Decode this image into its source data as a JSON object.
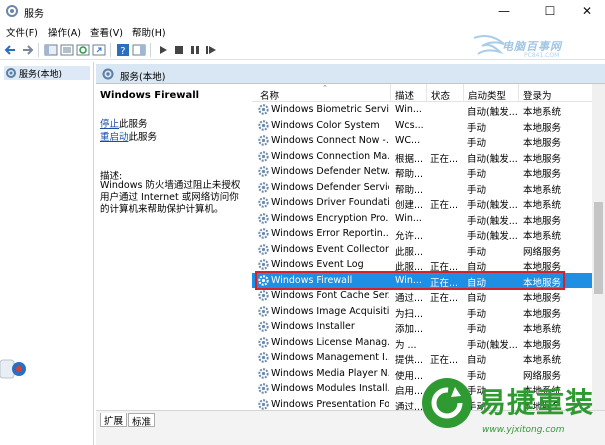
{
  "window": {
    "title": "服务",
    "minimize": "—",
    "maximize": "☐",
    "close": "✕"
  },
  "menu": [
    "文件(F)",
    "操作(A)",
    "查看(V)",
    "帮助(H)"
  ],
  "watermark": {
    "text": "电脑百事网",
    "sub": "PC841.COM"
  },
  "tree": {
    "item": "服务(本地)"
  },
  "panel": {
    "header": "服务(本地)"
  },
  "details": {
    "title": "Windows Firewall",
    "stop_link": "停止",
    "stop_suffix": "此服务",
    "restart_link": "重启动",
    "restart_suffix": "此服务",
    "desc_label": "描述:",
    "desc_text": "Windows 防火墙通过阻止未授权用户通过 Internet 或网络访问你的计算机来帮助保护计算机。"
  },
  "columns": {
    "name": "名称",
    "desc": "描述",
    "status": "状态",
    "startup": "启动类型",
    "logon": "登录为"
  },
  "services": [
    {
      "name": "Windows Biometric Servi...",
      "desc": "Win...",
      "status": "",
      "startup": "自动(触发...",
      "logon": "本地系统"
    },
    {
      "name": "Windows Color System",
      "desc": "Wcs...",
      "status": "",
      "startup": "手动",
      "logon": "本地服务"
    },
    {
      "name": "Windows Connect Now -...",
      "desc": "WC...",
      "status": "",
      "startup": "手动",
      "logon": "本地服务"
    },
    {
      "name": "Windows Connection Ma...",
      "desc": "根据...",
      "status": "正在...",
      "startup": "自动(触发...",
      "logon": "本地服务"
    },
    {
      "name": "Windows Defender Netw...",
      "desc": "帮助...",
      "status": "",
      "startup": "手动",
      "logon": "本地服务"
    },
    {
      "name": "Windows Defender Service",
      "desc": "帮助...",
      "status": "",
      "startup": "手动",
      "logon": "本地系统"
    },
    {
      "name": "Windows Driver Foundati...",
      "desc": "创建...",
      "status": "正在...",
      "startup": "手动(触发...",
      "logon": "本地系统"
    },
    {
      "name": "Windows Encryption Pro...",
      "desc": "Win...",
      "status": "",
      "startup": "手动(触发...",
      "logon": "本地服务"
    },
    {
      "name": "Windows Error Reportin...",
      "desc": "允许...",
      "status": "",
      "startup": "手动(触发...",
      "logon": "本地系统"
    },
    {
      "name": "Windows Event Collector",
      "desc": "此服...",
      "status": "",
      "startup": "手动",
      "logon": "网络服务"
    },
    {
      "name": "Windows Event Log",
      "desc": "此服...",
      "status": "正在...",
      "startup": "自动",
      "logon": "本地服务"
    },
    {
      "name": "Windows Firewall",
      "desc": "Win...",
      "status": "正在...",
      "startup": "自动",
      "logon": "本地服务"
    },
    {
      "name": "Windows Font Cache Ser...",
      "desc": "通过...",
      "status": "正在...",
      "startup": "自动",
      "logon": "本地服务"
    },
    {
      "name": "Windows Image Acquisiti...",
      "desc": "为扫...",
      "status": "",
      "startup": "手动",
      "logon": "本地服务"
    },
    {
      "name": "Windows Installer",
      "desc": "添加...",
      "status": "",
      "startup": "手动",
      "logon": "本地系统"
    },
    {
      "name": "Windows License Manag...",
      "desc": "为 ...",
      "status": "",
      "startup": "手动(触发...",
      "logon": "本地服务"
    },
    {
      "name": "Windows Management I...",
      "desc": "提供...",
      "status": "正在...",
      "startup": "自动",
      "logon": "本地系统"
    },
    {
      "name": "Windows Media Player N...",
      "desc": "使用...",
      "status": "",
      "startup": "手动",
      "logon": "网络服务"
    },
    {
      "name": "Windows Modules Install...",
      "desc": "启用...",
      "status": "",
      "startup": "手动",
      "logon": "本地系统"
    },
    {
      "name": "Windows Presentation Fo...",
      "desc": "通过...",
      "status": "",
      "startup": "手动",
      "logon": "本地服务"
    }
  ],
  "tabs": [
    "扩展",
    "标准"
  ],
  "logo": {
    "brand": "易捷重装",
    "url": "www.yjxitong.com"
  },
  "colors": {
    "selection": "#1e8fe2",
    "highlight": "#d8202a",
    "logo": "#2f9a32"
  }
}
